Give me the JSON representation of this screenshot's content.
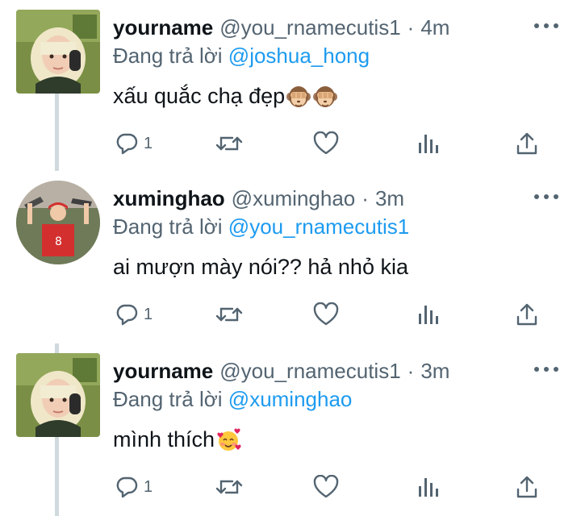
{
  "tweets": [
    {
      "display_name": "yourname",
      "handle": "@you_rnamecutis1",
      "separator": "·",
      "time": "4m",
      "reply_prefix": "Đang trả lời",
      "reply_to": "@joshua_hong",
      "text": "xấu quắc chạ đẹp",
      "emojis": [
        "see-no-evil-monkey-emoji",
        "see-no-evil-monkey-emoji"
      ],
      "reply_count": "1",
      "avatar": "blonde-person-photo"
    },
    {
      "display_name": "xuminghao",
      "handle": "@xuminghao",
      "separator": "·",
      "time": "3m",
      "reply_prefix": "Đang trả lời",
      "reply_to": "@you_rnamecutis1",
      "text": "ai mượn mày nói?? hả nhỏ kia",
      "emojis": [],
      "reply_count": "1",
      "avatar": "red-jersey-person-photo"
    },
    {
      "display_name": "yourname",
      "handle": "@you_rnamecutis1",
      "separator": "·",
      "time": "3m",
      "reply_prefix": "Đang trả lời",
      "reply_to": "@xuminghao",
      "text": "mình thích",
      "emojis": [
        "smiling-face-with-hearts-emoji"
      ],
      "reply_count": "1",
      "avatar": "blonde-person-photo"
    }
  ],
  "icons": {
    "reply": "reply-icon",
    "retweet": "retweet-icon",
    "like": "heart-icon",
    "stats": "stats-icon",
    "share": "share-icon",
    "more": "more-icon"
  },
  "colors": {
    "text": "#0f1419",
    "secondary": "#536471",
    "link": "#1d9bf0",
    "thread_line": "#cfd9de"
  }
}
